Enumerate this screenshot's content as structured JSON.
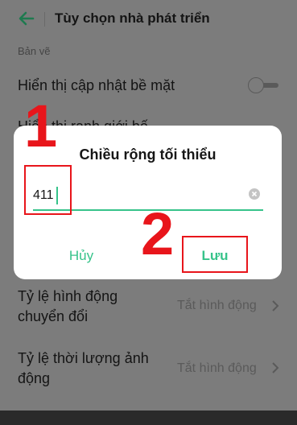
{
  "header": {
    "title": "Tùy chọn nhà phát triển",
    "back_icon": "arrow-left-icon"
  },
  "section_label": "Bản vẽ",
  "settings": [
    {
      "label": "Hiển thị cập nhật bề mặt",
      "control": "toggle",
      "state": "off"
    },
    {
      "label": "Tỷ lệ hình động chuyển đổi",
      "line1": "Tỷ lệ hình động",
      "line2": "chuyển đổi",
      "value": "Tắt hình động"
    },
    {
      "label": "Tỷ lệ thời lượng ảnh động",
      "line1": "Tỷ lệ thời lượng ảnh",
      "line2": "động",
      "value": "Tắt hình động"
    }
  ],
  "dialog": {
    "title": "Chiều rộng tối thiểu",
    "input_value": "411",
    "cancel_label": "Hủy",
    "save_label": "Lưu"
  },
  "annotations": {
    "step1": "1",
    "step2": "2"
  },
  "colors": {
    "accent": "#36c38a",
    "annotation": "#e8151b",
    "overlay_background": "#7c7c7c"
  }
}
